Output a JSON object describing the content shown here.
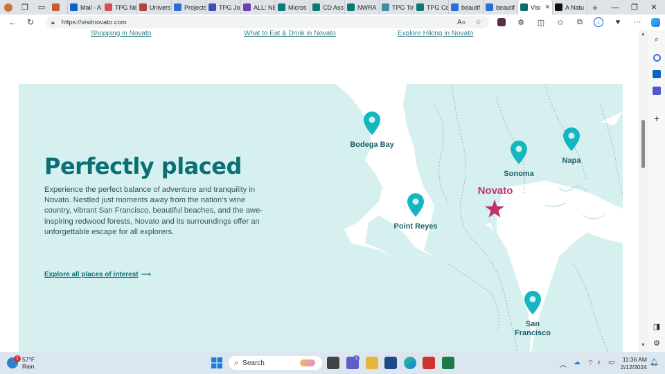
{
  "browser": {
    "tabs": [
      {
        "label": "",
        "color": "#c75b2b"
      },
      {
        "label": "Mail - A",
        "color": "#0a64c8"
      },
      {
        "label": "TPG Ne",
        "color": "#d94f4f"
      },
      {
        "label": "Univers",
        "color": "#b0443f"
      },
      {
        "label": "Projects",
        "color": "#2b6fd6"
      },
      {
        "label": "TPG Jo",
        "color": "#3b4fb8"
      },
      {
        "label": "ALL: NE",
        "color": "#6b3fb8"
      },
      {
        "label": "Micros",
        "color": "#0b7a75"
      },
      {
        "label": "CD Ass",
        "color": "#0b7a75"
      },
      {
        "label": "NWRA",
        "color": "#0b7a75"
      },
      {
        "label": "TPG Tim",
        "color": "#3b8fa0"
      },
      {
        "label": "TPG Co",
        "color": "#0b7a75"
      },
      {
        "label": "beautif",
        "color": "#2b6fd6"
      },
      {
        "label": "beautif",
        "color": "#2b6fd6"
      },
      {
        "label": "Visi",
        "color": "#0b6f74",
        "active": true
      },
      {
        "label": "A Natu",
        "color": "#111111"
      }
    ],
    "url": "https://visitnovato.com"
  },
  "page": {
    "top_links": [
      "Shopping in Novato",
      "What to Eat & Drink in Novato",
      "Explore Hiking in Novato"
    ],
    "headline": "Perfectly placed",
    "body": "Experience the perfect balance of adventure and tranquility in Novato. Nestled just moments away from the nation’s wine country, vibrant San Francisco, beautiful beaches, and the awe-inspiring redwood forests, Novato and its surroundings offer an unforgettable escape for all explorers.",
    "cta": "Explore all places of interest",
    "cta_arrow": "⟶",
    "places": {
      "bodega_bay": "Bodega Bay",
      "sonoma": "Sonoma",
      "napa": "Napa",
      "novato": "Novato",
      "point_reyes": "Point Reyes",
      "san_francisco_1": "San",
      "san_francisco_2": "Francisco"
    },
    "colors": {
      "map_land": "#d6f0f0",
      "map_water": "#ffffff",
      "pin": "#14b6bf",
      "star": "#c0306a"
    }
  },
  "taskbar": {
    "temp": "57°F",
    "weather": "Rain",
    "search": "Search",
    "time": "11:36 AM",
    "date": "2/12/2024",
    "weather_badge": "1",
    "chat_badge": "1"
  }
}
